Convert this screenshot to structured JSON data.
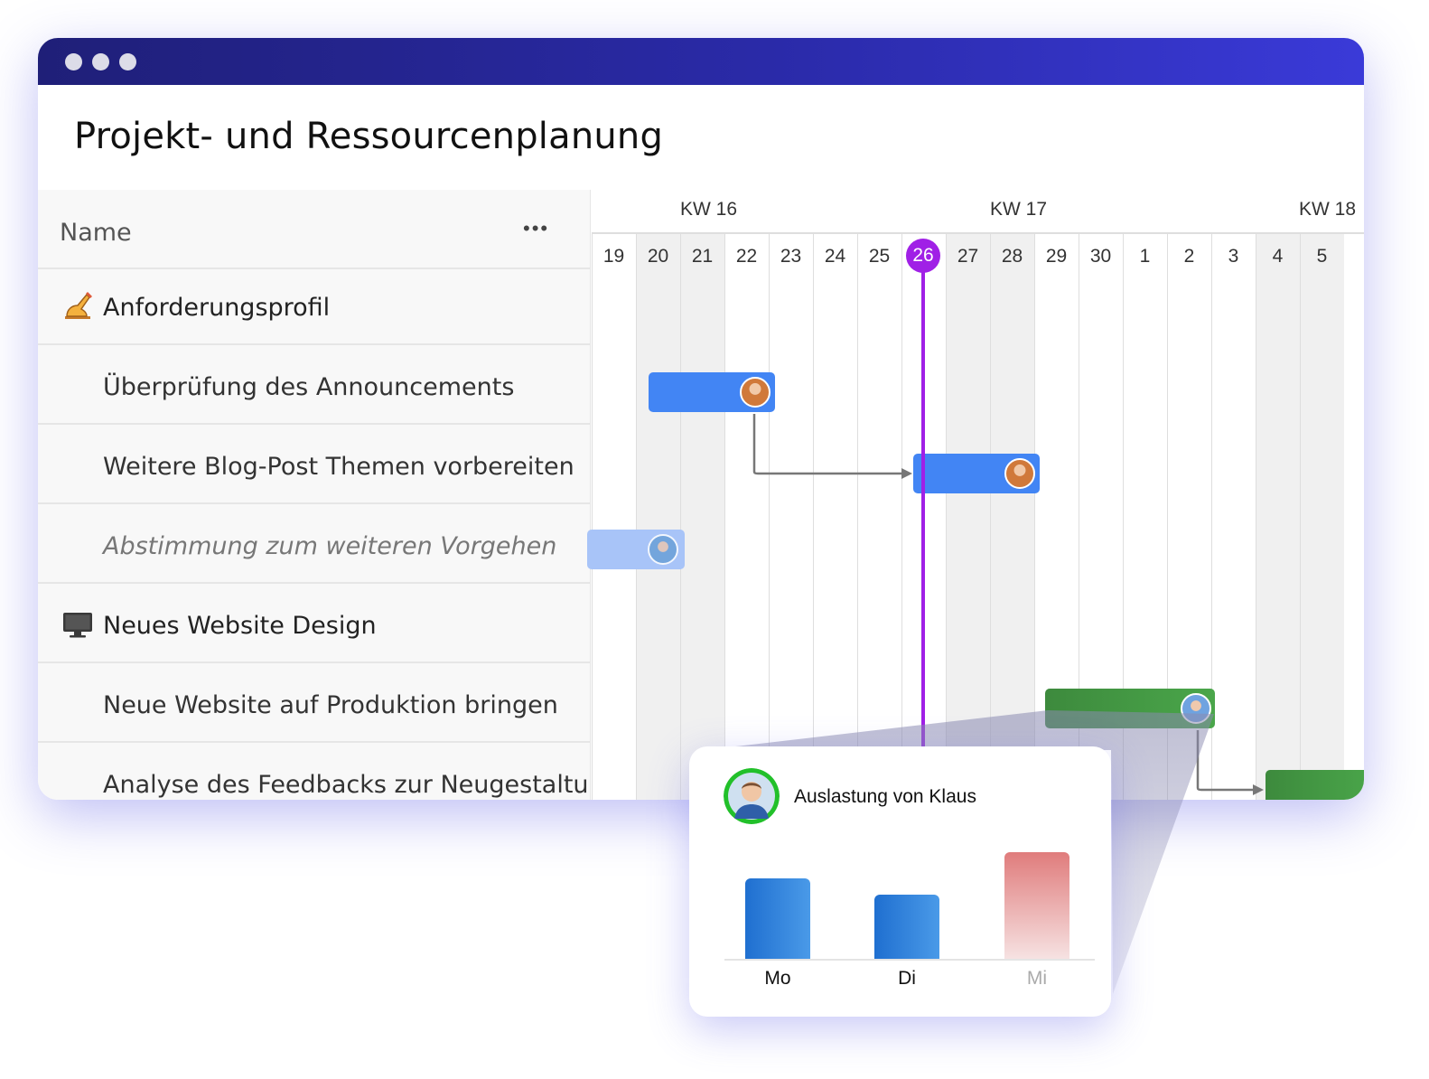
{
  "window": {
    "title": "Projekt- und Ressourcenplanung"
  },
  "table": {
    "header": "Name",
    "more_icon": "•••",
    "rows": [
      {
        "label": "Anforderungsprofil",
        "type": "group",
        "icon": "writing-hand-icon"
      },
      {
        "label": "Überprüfung des Announcements",
        "type": "task"
      },
      {
        "label": "Weitere Blog-Post Themen vorbereiten",
        "type": "task"
      },
      {
        "label": "Abstimmung zum weiteren Vorgehen",
        "type": "task",
        "style": "italic"
      },
      {
        "label": "Neues Website Design",
        "type": "group",
        "icon": "monitor-icon"
      },
      {
        "label": "Neue Website auf Produktion bringen",
        "type": "task"
      },
      {
        "label": "Analyse des Feedbacks zur Neugestaltu",
        "type": "task"
      }
    ]
  },
  "timeline": {
    "weeks": [
      "KW 16",
      "KW 17",
      "KW 18"
    ],
    "days": [
      "19",
      "20",
      "21",
      "22",
      "23",
      "24",
      "25",
      "26",
      "27",
      "28",
      "29",
      "30",
      "1",
      "2",
      "3",
      "4",
      "5"
    ],
    "today": "26",
    "colors": {
      "today": "#a020e6",
      "blue_bar": "#4285f4",
      "green_bar": "#43a047"
    }
  },
  "popup": {
    "title": "Auslastung von Klaus",
    "avatar_icon": "user-avatar-icon",
    "chart_data": {
      "type": "bar",
      "categories": [
        "Mo",
        "Di",
        "Mi"
      ],
      "values": [
        0.75,
        0.6,
        1.0
      ],
      "colors": [
        "#2f80d8",
        "#2f80d8",
        "#e78a8a"
      ]
    }
  }
}
